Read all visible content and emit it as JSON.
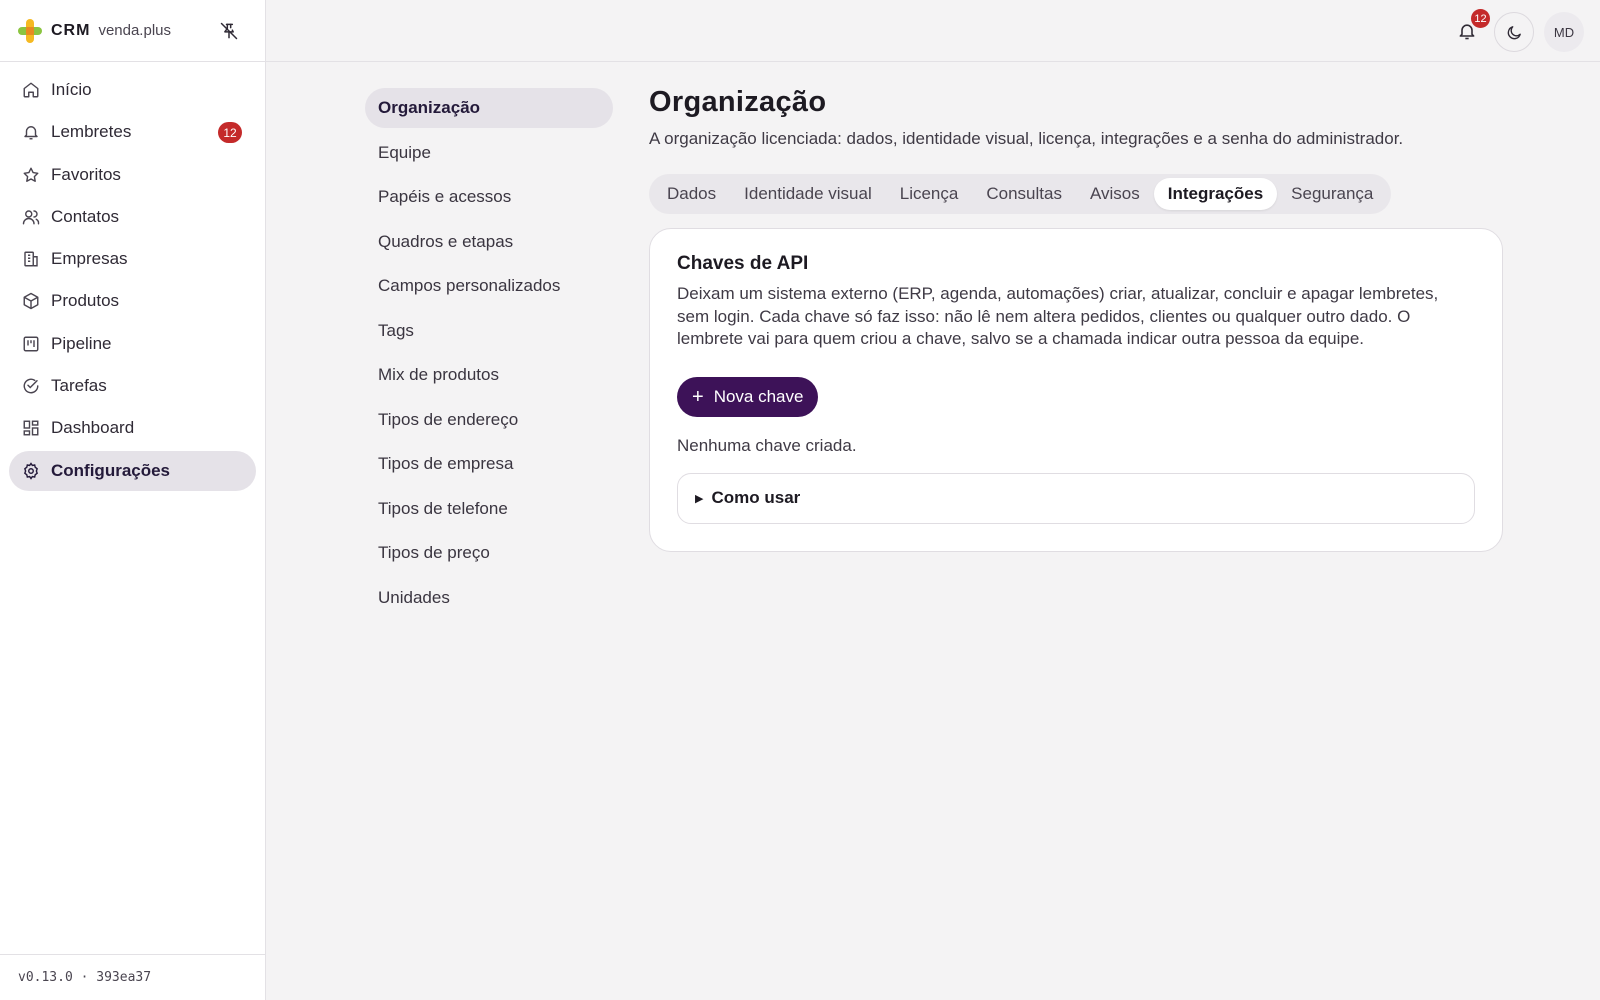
{
  "brand": {
    "name": "CRM",
    "sub": "venda.plus"
  },
  "sidebar": {
    "items": [
      {
        "label": "Início",
        "icon": "home-icon"
      },
      {
        "label": "Lembretes",
        "icon": "bell-icon",
        "badge": "12"
      },
      {
        "label": "Favoritos",
        "icon": "star-icon"
      },
      {
        "label": "Contatos",
        "icon": "users-icon"
      },
      {
        "label": "Empresas",
        "icon": "building-icon"
      },
      {
        "label": "Produtos",
        "icon": "package-icon"
      },
      {
        "label": "Pipeline",
        "icon": "kanban-icon"
      },
      {
        "label": "Tarefas",
        "icon": "check-circle-icon"
      },
      {
        "label": "Dashboard",
        "icon": "dashboard-icon"
      },
      {
        "label": "Configurações",
        "icon": "gear-icon"
      }
    ],
    "version": "v0.13.0 · 393ea37"
  },
  "topbar": {
    "notifications": "12",
    "avatar": "MD"
  },
  "subnav": {
    "items": [
      "Organização",
      "Equipe",
      "Papéis e acessos",
      "Quadros e etapas",
      "Campos personalizados",
      "Tags",
      "Mix de produtos",
      "Tipos de endereço",
      "Tipos de empresa",
      "Tipos de telefone",
      "Tipos de preço",
      "Unidades"
    ]
  },
  "main": {
    "title": "Organização",
    "description": "A organização licenciada: dados, identidade visual, licença, integrações e a senha do administrador.",
    "tabs": [
      "Dados",
      "Identidade visual",
      "Licença",
      "Consultas",
      "Avisos",
      "Integrações",
      "Segurança"
    ],
    "active_tab": "Integrações",
    "card": {
      "title": "Chaves de API",
      "description": "Deixam um sistema externo (ERP, agenda, automações) criar, atualizar, concluir e apagar lembretes, sem login. Cada chave só faz isso: não lê nem altera pedidos, clientes ou qualquer outro dado. O lembrete vai para quem criou a chave, salvo se a chamada indicar outra pessoa da equipe.",
      "button": "Nova chave",
      "empty": "Nenhuma chave criada.",
      "details": "Como usar"
    }
  },
  "colors": {
    "accent": "#3d1258",
    "badge": "#c42a2a",
    "active_bg": "#e5e2e8"
  }
}
